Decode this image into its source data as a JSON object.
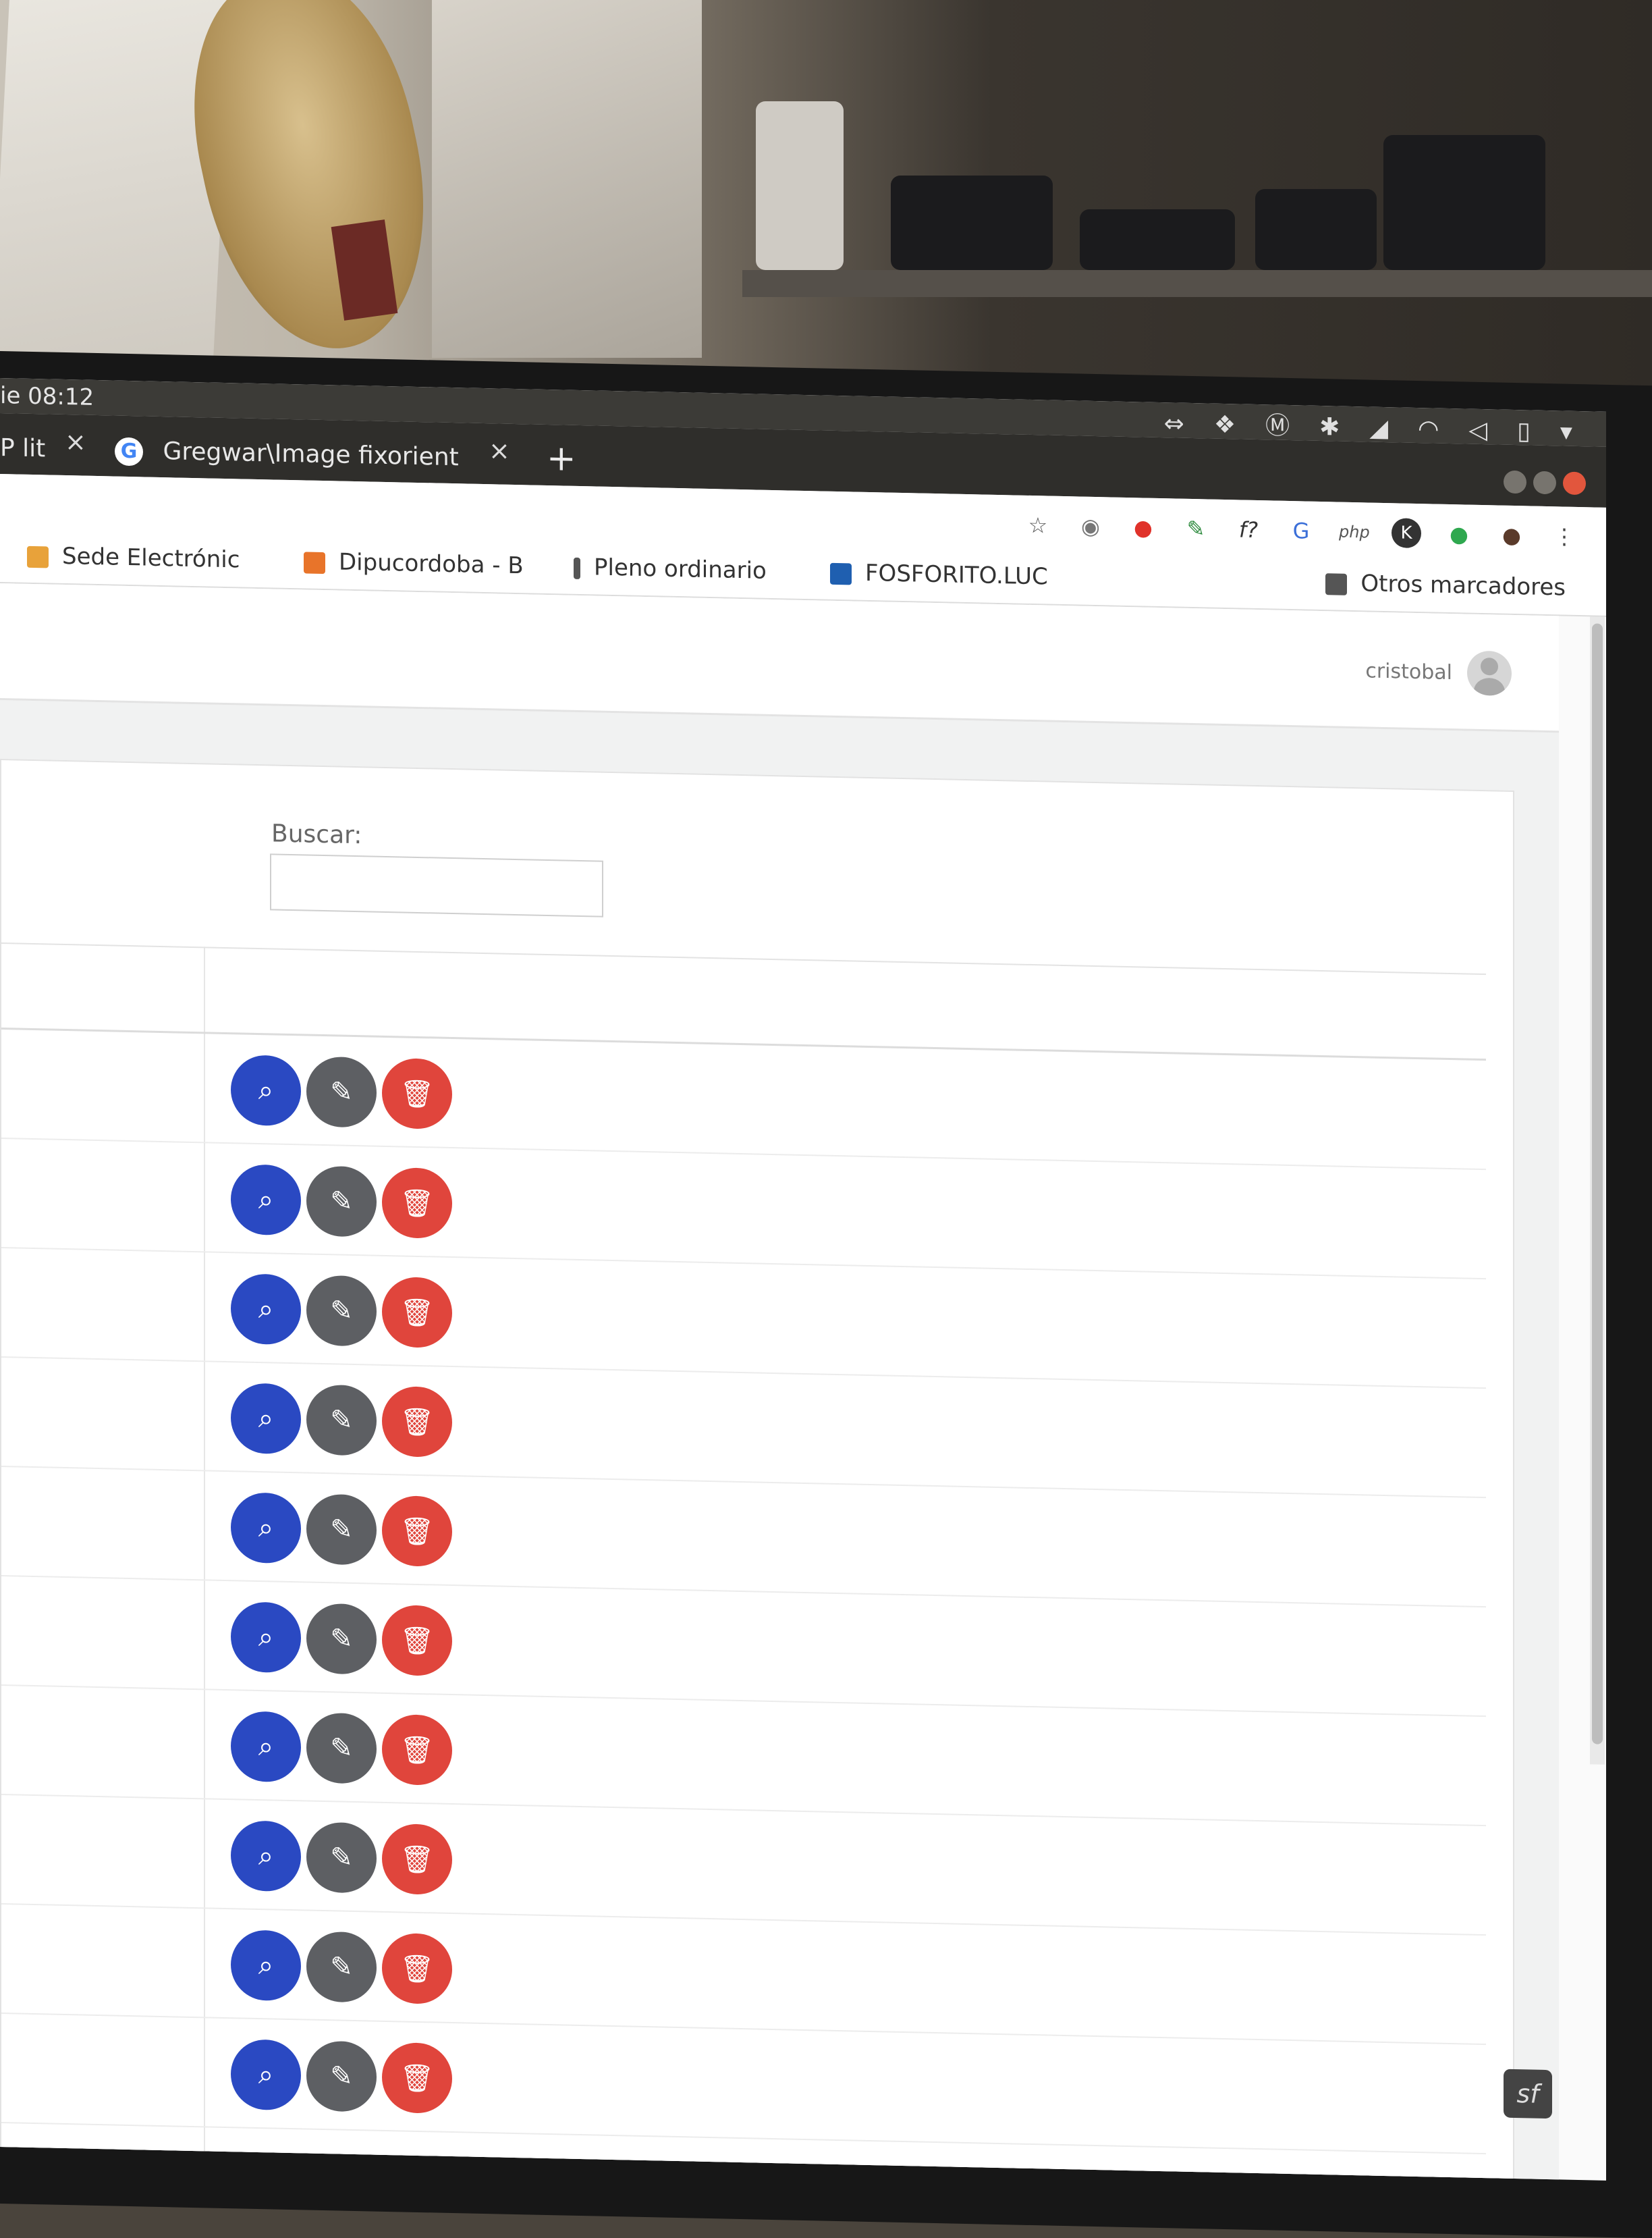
{
  "system_bar": {
    "clock": "ie 08:12",
    "tray_icons": [
      "teamviewer-icon",
      "dropbox-icon",
      "mega-icon",
      "bluetooth-icon",
      "connection-icon",
      "wifi-icon",
      "volume-icon",
      "battery-icon",
      "dropdown-icon"
    ]
  },
  "tabs": [
    {
      "label": "P lit",
      "close": "×"
    },
    {
      "label": "Gregwar\\Image fixorient",
      "close": "×"
    }
  ],
  "new_tab": "+",
  "toolbar": {
    "extensions": [
      {
        "name": "star-icon",
        "glyph": "☆"
      },
      {
        "name": "extension-seal-icon",
        "glyph": "◉"
      },
      {
        "name": "adblock-icon",
        "glyph": "●"
      },
      {
        "name": "eyedropper-icon",
        "glyph": "✎"
      },
      {
        "name": "function-icon",
        "glyph": "f?"
      },
      {
        "name": "translate-icon",
        "glyph": "G"
      },
      {
        "name": "php-icon",
        "glyph": "php"
      },
      {
        "name": "k-extension-icon",
        "glyph": "K"
      },
      {
        "name": "green-extension-icon",
        "glyph": "●"
      },
      {
        "name": "profile-icon",
        "glyph": "●"
      },
      {
        "name": "menu-icon",
        "glyph": "⋮"
      }
    ]
  },
  "bookmarks": [
    {
      "label": "Sede Electrónic",
      "color": "#e8a23a"
    },
    {
      "label": "Dipucordoba - B",
      "color": "#e8742a"
    },
    {
      "label": "Pleno ordinario",
      "color": "#555555"
    },
    {
      "label": "FOSFORITO.LUC",
      "color": "#1f5fb0"
    }
  ],
  "bookmarks_other": "Otros marcadores",
  "navbar": {
    "username": "cristobal"
  },
  "search": {
    "label": "Buscar:",
    "value": ""
  },
  "action_rows": 10,
  "colors": {
    "view": "#2a49c2",
    "edit": "#5d5f63",
    "delete": "#e0453c"
  }
}
